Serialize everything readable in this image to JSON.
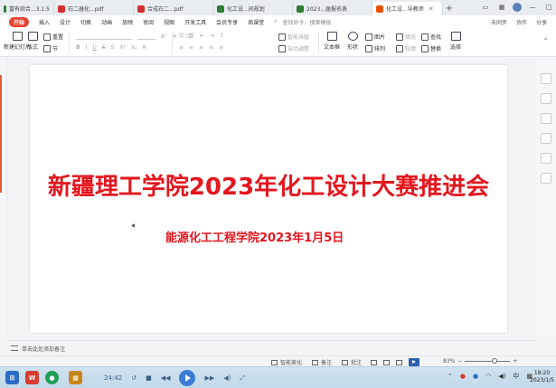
{
  "tabs": [
    {
      "label": "富有综合...3.1.5",
      "color": "#2e7d32"
    },
    {
      "label": "石二器化...pdf",
      "color": "#d32f2f"
    },
    {
      "label": "合成石二...pdf",
      "color": "#d32f2f"
    },
    {
      "label": "化工设...间规划",
      "color": "#2e7d32"
    },
    {
      "label": "2023...届报名表",
      "color": "#2e7d32"
    },
    {
      "label": "化工设...导教师",
      "color": "#e65100",
      "active": true
    }
  ],
  "window": {
    "plus": "+",
    "close": "✕"
  },
  "menu": {
    "start": "开始",
    "items": [
      "插入",
      "设计",
      "切换",
      "动画",
      "放映",
      "审阅",
      "视图",
      "开发工具",
      "会员专享",
      "商课堂"
    ],
    "search": "查找命令、搜索模板",
    "right": [
      "未同步",
      "协作",
      "分享"
    ]
  },
  "ribbon": {
    "new_slide": "新建幻灯片",
    "layout": "版式",
    "section": "节",
    "reset": "重置",
    "arrange": "智能排版",
    "auto_fit": "自动调整",
    "textbox": "文本框",
    "shape": "形状",
    "picture": "图片",
    "arrange2": "排列",
    "fill": "填充",
    "outline": "轮廓",
    "find": "查找",
    "replace": "替换",
    "select": "选择"
  },
  "slide": {
    "title": "新疆理工学院2023年化工设计大赛推进会",
    "subtitle": "能源化工工程学院2023年1月5日"
  },
  "notes": {
    "placeholder": "单击此处添加备注"
  },
  "status": {
    "beautify": "智能美化",
    "notes": "备注",
    "comment": "批注",
    "zoom": "83%"
  },
  "taskbar": {
    "time_elapsed": "24:42",
    "ime": "中",
    "clock_time": "18:20",
    "clock_date": "2023/1/5"
  },
  "colors": {
    "accent": "#e8412f",
    "slide_text": "#e4161e"
  }
}
